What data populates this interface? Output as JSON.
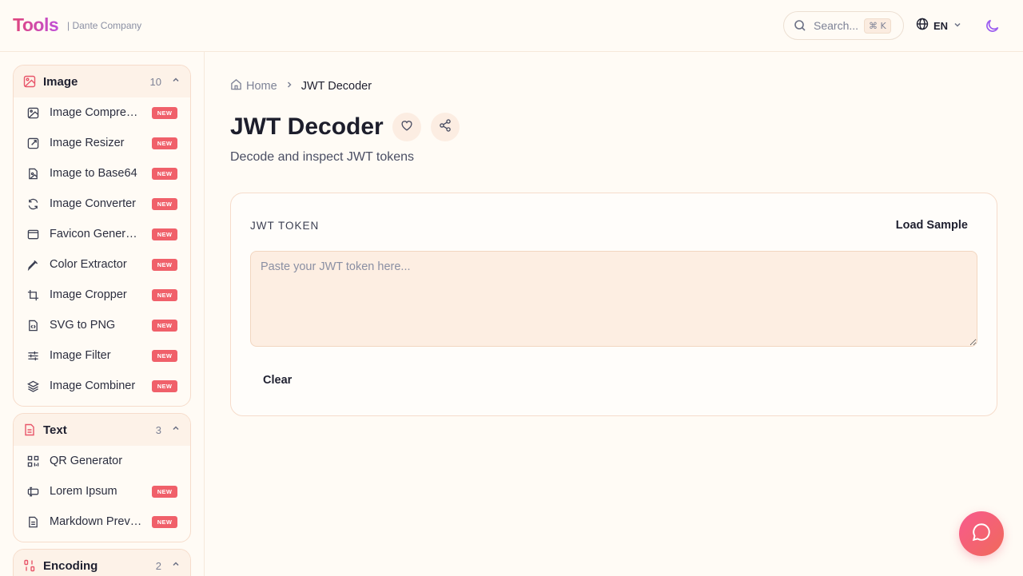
{
  "header": {
    "logo": "Tools",
    "company": "| Dante Company",
    "search_placeholder": "Search...",
    "search_shortcut": "⌘ K",
    "language": "EN"
  },
  "sidebar": {
    "groups": [
      {
        "title": "Image",
        "count": "10",
        "items": [
          {
            "label": "Image Compressor",
            "badge": "NEW"
          },
          {
            "label": "Image Resizer",
            "badge": "NEW"
          },
          {
            "label": "Image to Base64",
            "badge": "NEW"
          },
          {
            "label": "Image Converter",
            "badge": "NEW"
          },
          {
            "label": "Favicon Generator",
            "badge": "NEW"
          },
          {
            "label": "Color Extractor",
            "badge": "NEW"
          },
          {
            "label": "Image Cropper",
            "badge": "NEW"
          },
          {
            "label": "SVG to PNG",
            "badge": "NEW"
          },
          {
            "label": "Image Filter",
            "badge": "NEW"
          },
          {
            "label": "Image Combiner",
            "badge": "NEW"
          }
        ]
      },
      {
        "title": "Text",
        "count": "3",
        "items": [
          {
            "label": "QR Generator",
            "badge": ""
          },
          {
            "label": "Lorem Ipsum",
            "badge": "NEW"
          },
          {
            "label": "Markdown Preview",
            "badge": "NEW"
          }
        ]
      },
      {
        "title": "Encoding",
        "count": "2",
        "items": []
      }
    ]
  },
  "breadcrumb": {
    "home": "Home",
    "current": "JWT Decoder"
  },
  "page": {
    "title": "JWT Decoder",
    "subtitle": "Decode and inspect JWT tokens"
  },
  "card": {
    "label": "JWT TOKEN",
    "load_sample": "Load Sample",
    "input_placeholder": "Paste your JWT token here...",
    "input_value": "",
    "clear": "Clear"
  },
  "colors": {
    "accent": "#e0457b",
    "badge": "#f0606a",
    "background": "#fffbf5"
  }
}
